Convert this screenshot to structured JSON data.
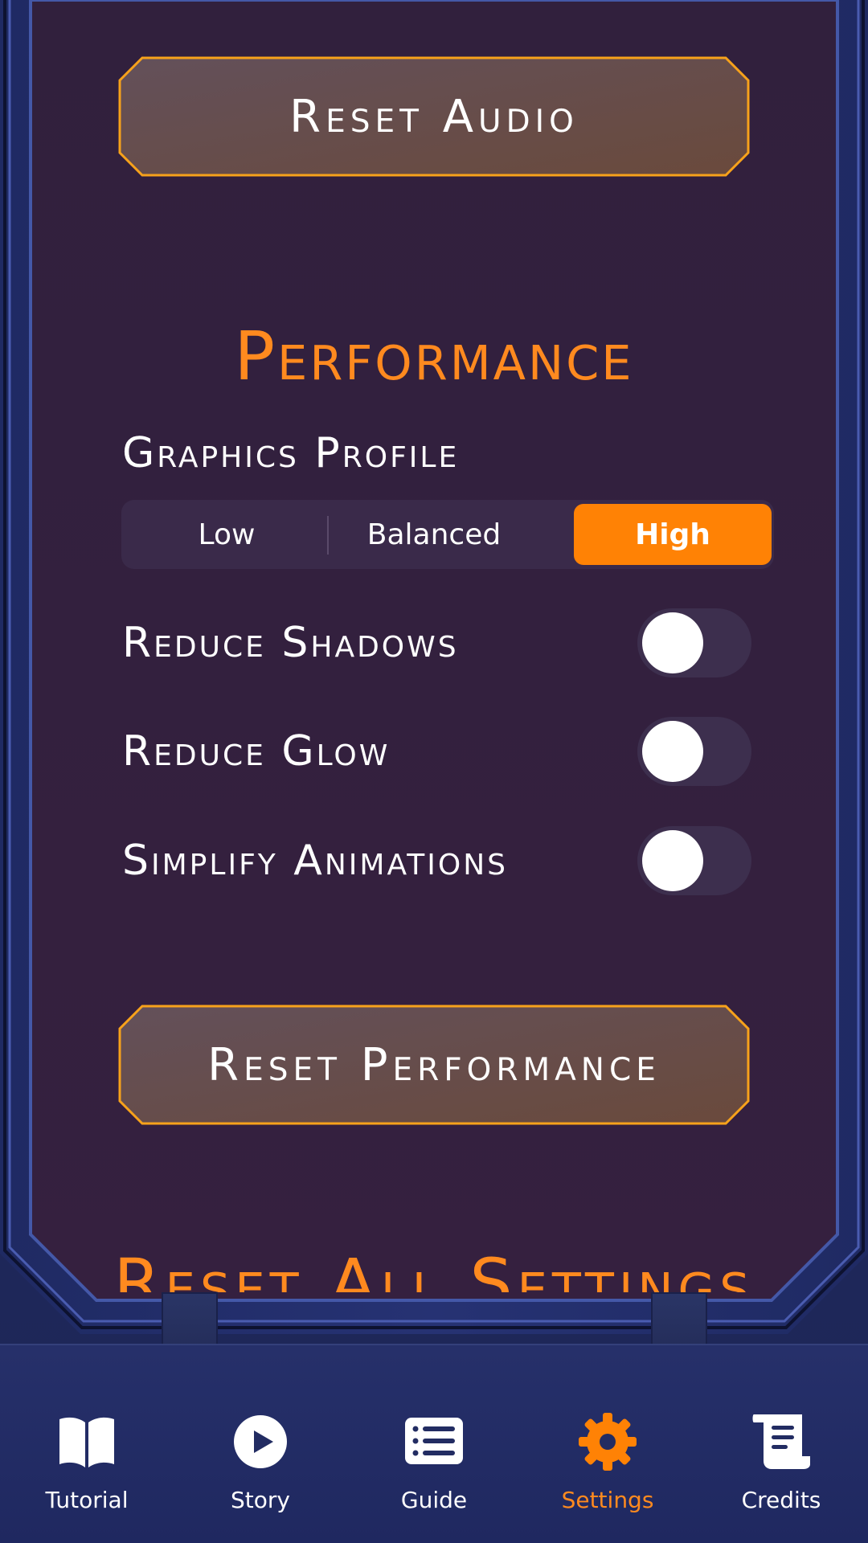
{
  "audio": {
    "reset_label": "Reset Audio"
  },
  "performance": {
    "title": "Performance",
    "graphics_profile_label": "Graphics Profile",
    "graphics_options": [
      "Low",
      "Balanced",
      "High"
    ],
    "graphics_selected": "High",
    "toggles": [
      {
        "label": "Reduce Shadows",
        "on": false
      },
      {
        "label": "Reduce Glow",
        "on": false
      },
      {
        "label": "Simplify Animations",
        "on": false
      }
    ],
    "reset_label": "Reset Performance"
  },
  "reset_all": {
    "title": "Reset All Settings"
  },
  "tabbar": {
    "items": [
      {
        "label": "Tutorial",
        "icon": "book-icon"
      },
      {
        "label": "Story",
        "icon": "play-circle-icon"
      },
      {
        "label": "Guide",
        "icon": "list-icon"
      },
      {
        "label": "Settings",
        "icon": "gear-icon"
      },
      {
        "label": "Credits",
        "icon": "scroll-icon"
      }
    ],
    "active": "Settings"
  },
  "colors": {
    "accent": "#ff8205",
    "title_orange": "#ff8a1f",
    "panel_bg": "#33203f",
    "frame_blue": "#2a3672",
    "button_border": "#f7a21b"
  }
}
